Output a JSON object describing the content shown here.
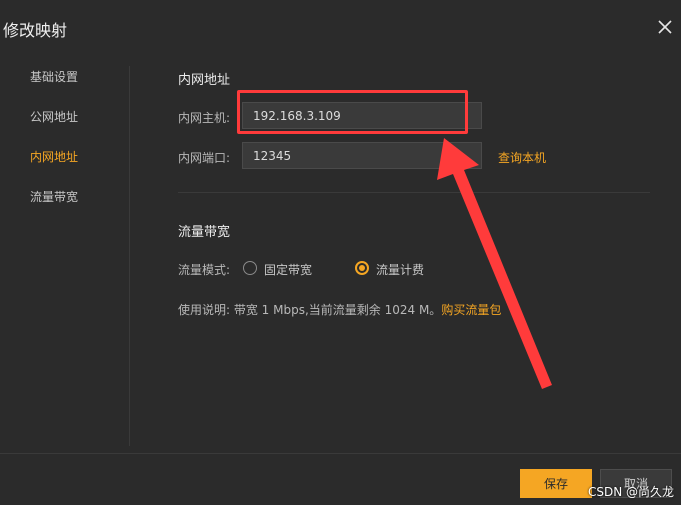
{
  "dialog": {
    "title": "修改映射"
  },
  "sidebar": {
    "items": [
      {
        "label": "基础设置"
      },
      {
        "label": "公网地址"
      },
      {
        "label": "内网地址"
      },
      {
        "label": "流量带宽"
      }
    ],
    "active": "内网地址"
  },
  "intranet": {
    "section_title": "内网地址",
    "host_label": "内网主机:",
    "host_value": "192.168.3.109",
    "port_label": "内网端口:",
    "port_value": "12345",
    "query_link": "查询本机"
  },
  "traffic": {
    "section_title": "流量带宽",
    "mode_label": "流量模式:",
    "options": [
      {
        "label": "固定带宽"
      },
      {
        "label": "流量计费"
      }
    ],
    "selected": "流量计费",
    "desc_prefix": "使用说明: 带宽 1 Mbps,当前流量剩余 1024 M。",
    "desc_link": "购买流量包"
  },
  "footer": {
    "save_label": "保存",
    "cancel_label": "取消"
  },
  "watermark": "CSDN @尚久龙",
  "colors": {
    "accent": "#f5a623",
    "annotation": "#ff3b3b",
    "background": "#2b2b2b"
  }
}
